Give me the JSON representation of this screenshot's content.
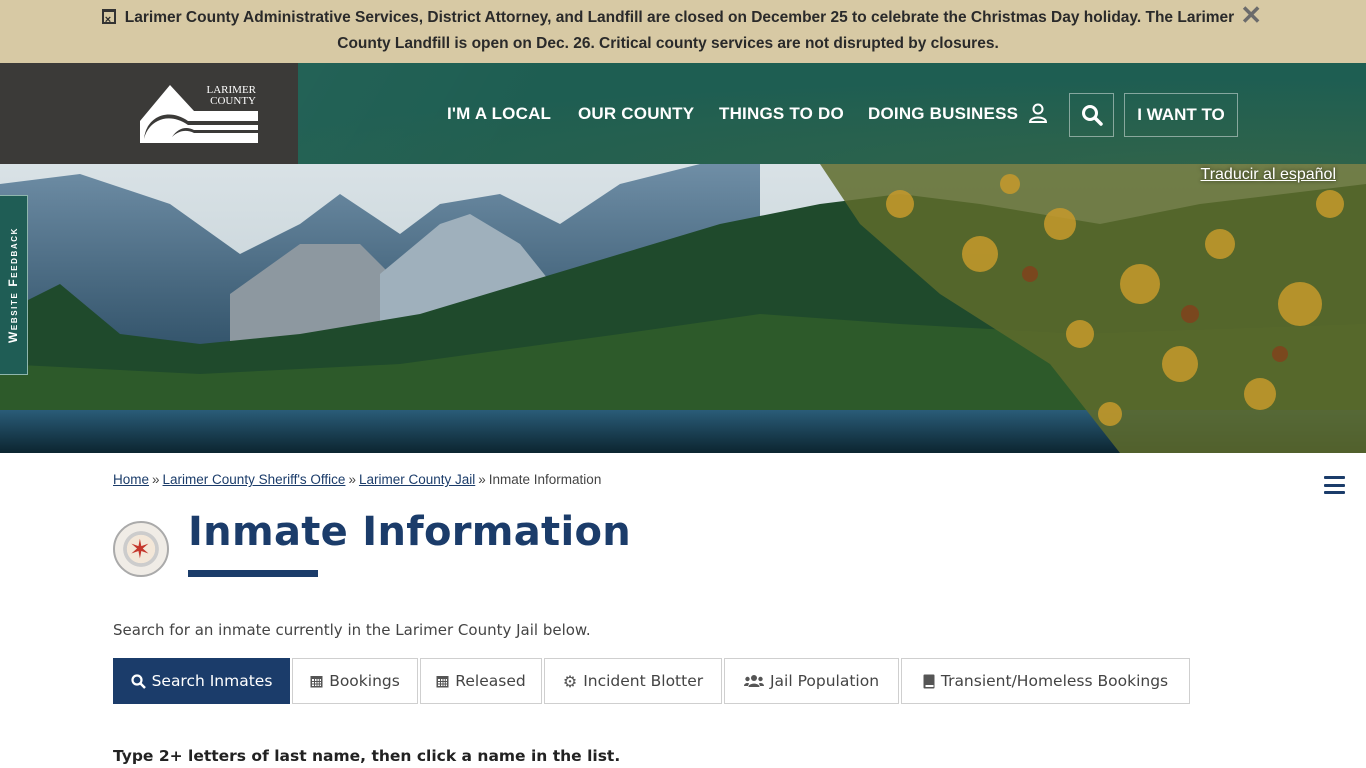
{
  "alert": {
    "message": "Larimer County Administrative Services, District Attorney, and Landfill are closed on December 25 to celebrate the Christmas Day holiday. The Larimer County Landfill is open on Dec. 26. Critical county services are not disrupted by closures.",
    "close_label": "✕"
  },
  "logo": {
    "line1": "LARIMER",
    "line2": "COUNTY"
  },
  "nav": {
    "items": [
      "I'M A LOCAL",
      "OUR COUNTY",
      "THINGS TO DO",
      "DOING BUSINESS"
    ],
    "i_want_to": "I WANT TO"
  },
  "hero": {
    "translate_link": "Traducir al español"
  },
  "feedback": {
    "label": "Website Feedback"
  },
  "breadcrumb": {
    "items": [
      "Home",
      "Larimer County Sheriff's Office",
      "Larimer County Jail"
    ],
    "current": "Inmate Information",
    "separator": "»"
  },
  "page": {
    "title": "Inmate Information",
    "intro": "Search for an inmate currently in the Larimer County Jail below.",
    "instruction": "Type 2+ letters of last name, then click a name in the list."
  },
  "tabs": [
    {
      "label": "Search Inmates",
      "icon": "search-icon",
      "active": true
    },
    {
      "label": "Bookings",
      "icon": "calendar-icon",
      "active": false
    },
    {
      "label": "Released",
      "icon": "calendar-icon",
      "active": false
    },
    {
      "label": "Incident Blotter",
      "icon": "gear-icon",
      "active": false
    },
    {
      "label": "Jail Population",
      "icon": "users-icon",
      "active": false
    },
    {
      "label": "Transient/Homeless Bookings",
      "icon": "book-icon",
      "active": false
    }
  ],
  "colors": {
    "brand_navy": "#1b3c6a",
    "header_green": "#1e5e52",
    "alert_tan": "#d7c9a4"
  }
}
